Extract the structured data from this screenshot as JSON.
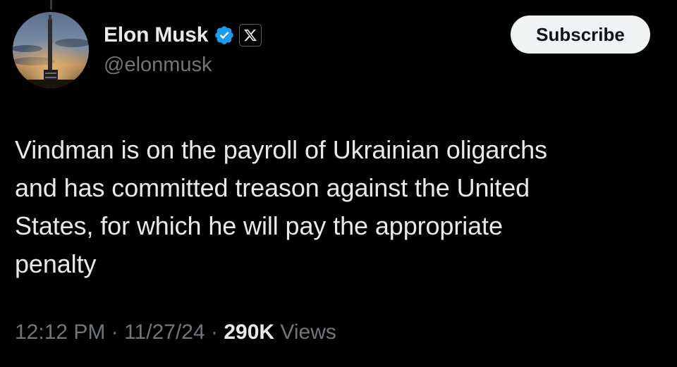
{
  "author": {
    "display_name": "Elon Musk",
    "handle": "@elonmusk",
    "avatar_icon": "rocket-launch-avatar",
    "verified_icon": "verified-badge-icon",
    "verified_color": "#1d9bf0",
    "affiliate_icon": "x-logo-icon"
  },
  "actions": {
    "subscribe_label": "Subscribe"
  },
  "tweet": {
    "text": "Vindman is on the payroll of Ukrainian oligarchs\nand has committed treason against the United\nStates, for which he will pay the appropriate\npenalty"
  },
  "meta": {
    "time": "12:12 PM",
    "separator": " · ",
    "date": "11/27/24",
    "views_count": "290K",
    "views_label": " Views"
  },
  "colors": {
    "background": "#000000",
    "text_primary": "#e7e9ea",
    "text_secondary": "#71767b",
    "button_bg": "#eff3f4",
    "button_text": "#0f1419"
  }
}
